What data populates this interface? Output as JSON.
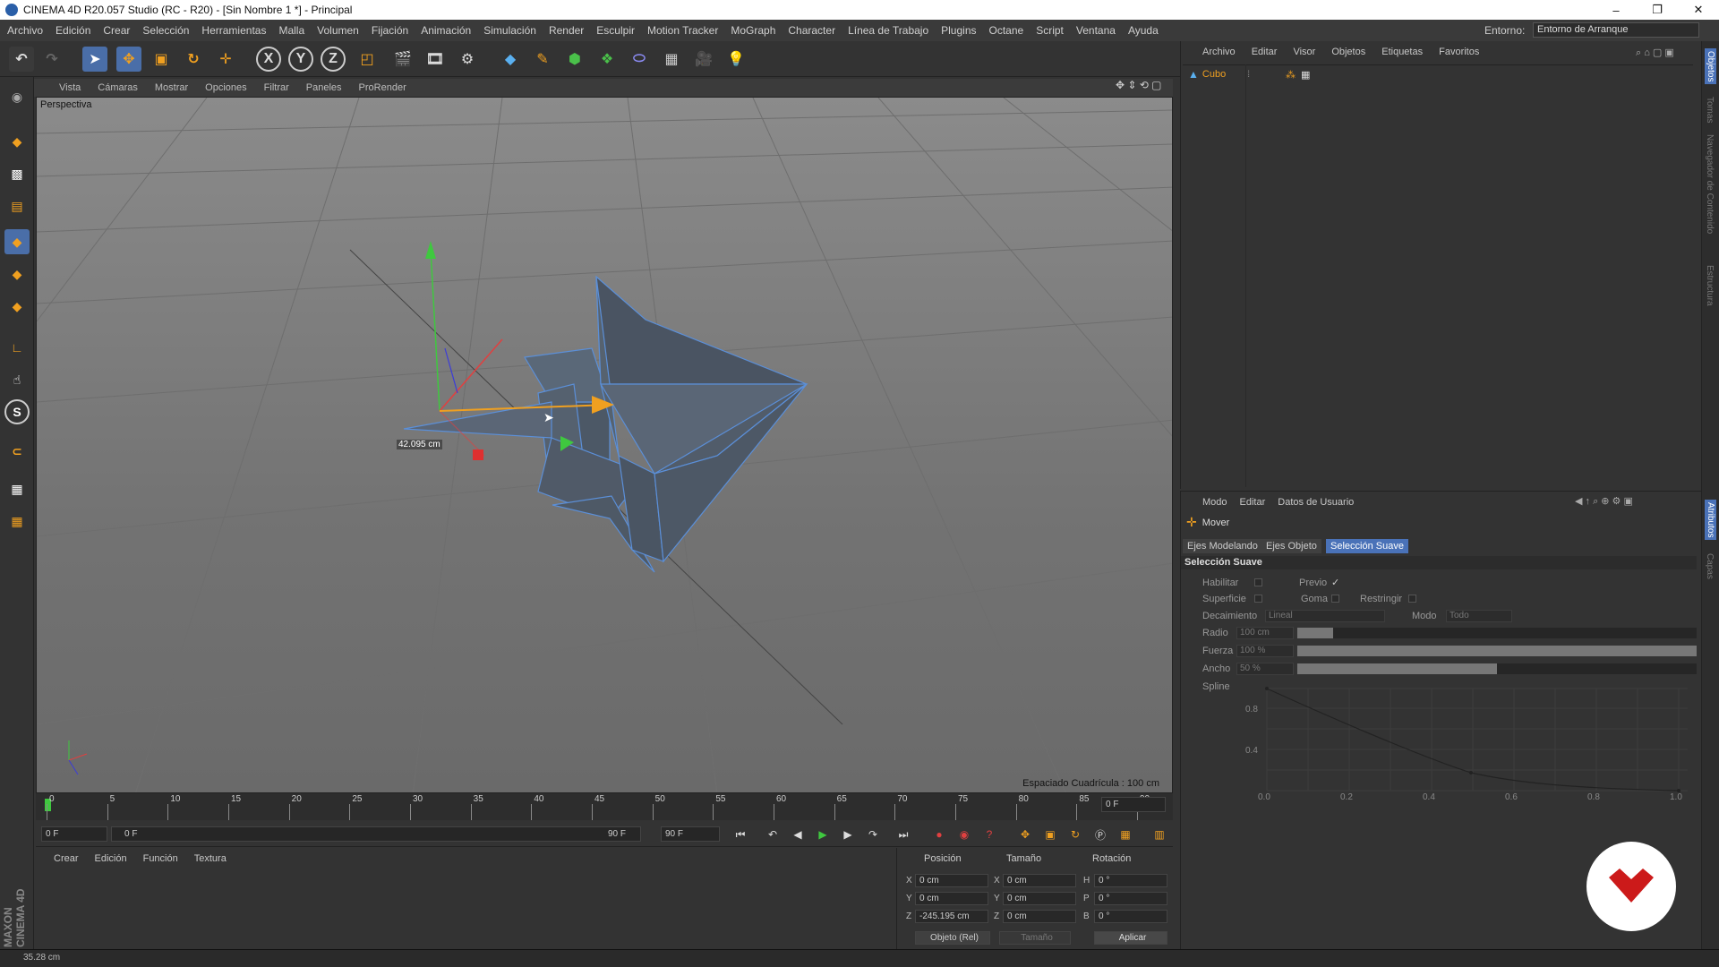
{
  "window": {
    "title": "CINEMA 4D R20.057 Studio (RC - R20) - [Sin Nombre 1 *] - Principal",
    "minimize": "–",
    "maximize": "❐",
    "close": "✕"
  },
  "menubar": {
    "items": [
      "Archivo",
      "Edición",
      "Crear",
      "Selección",
      "Herramientas",
      "Malla",
      "Volumen",
      "Fijación",
      "Animación",
      "Simulación",
      "Render",
      "Esculpir",
      "Motion Tracker",
      "MoGraph",
      "Character",
      "Línea de Trabajo",
      "Plugins",
      "Octane",
      "Script",
      "Ventana",
      "Ayuda"
    ],
    "env_label": "Entorno:",
    "env_value": "Entorno de Arranque"
  },
  "toolbar": {
    "axis_x": "X",
    "axis_y": "Y",
    "axis_z": "Z"
  },
  "lefttools": {
    "s_label": "S"
  },
  "viewport": {
    "menu": [
      "Vista",
      "Cámaras",
      "Mostrar",
      "Opciones",
      "Filtrar",
      "Paneles",
      "ProRender"
    ],
    "label": "Perspectiva",
    "grid_spacing": "Espaciado Cuadrícula : 100 cm",
    "measure": "42.095 cm"
  },
  "timeline": {
    "ticks": [
      "0",
      "5",
      "10",
      "15",
      "20",
      "25",
      "30",
      "35",
      "40",
      "45",
      "50",
      "55",
      "60",
      "65",
      "70",
      "75",
      "80",
      "85",
      "90"
    ],
    "current_frame": "0 F",
    "start_field": "0 F",
    "range_start": "0 F",
    "range_end": "90 F",
    "end_field": "90 F",
    "right_field": "0 F"
  },
  "materials": {
    "menu": [
      "Crear",
      "Edición",
      "Función",
      "Textura"
    ]
  },
  "coords": {
    "pos_hdr": "Posición",
    "size_hdr": "Tamaño",
    "rot_hdr": "Rotación",
    "px": "0 cm",
    "py": "0 cm",
    "pz": "-245.195 cm",
    "sx": "0 cm",
    "sy": "0 cm",
    "sz": "0 cm",
    "rh": "0 °",
    "rp": "0 °",
    "rb": "0 °",
    "lx": "X",
    "ly": "Y",
    "lz": "Z",
    "lh": "H",
    "lp": "P",
    "lb": "B",
    "mode": "Objeto (Rel)",
    "size_mode": "Tamaño",
    "apply": "Aplicar"
  },
  "objects": {
    "menu": [
      "Archivo",
      "Editar",
      "Visor",
      "Objetos",
      "Etiquetas",
      "Favoritos"
    ],
    "items": [
      {
        "name": "Cubo"
      }
    ]
  },
  "attributes": {
    "menu": [
      "Modo",
      "Editar",
      "Datos de Usuario"
    ],
    "tool": "Mover",
    "tabs": [
      "Ejes Modelando",
      "Ejes Objeto",
      "Selección Suave"
    ],
    "active_tab": "Selección Suave",
    "section": "Selección Suave",
    "habilitar": "Habilitar",
    "previo": "Previo",
    "previo_check": "✓",
    "superficie": "Superficie",
    "goma": "Goma",
    "restringir": "Restringir",
    "decaimiento": "Decaimiento",
    "decaimiento_val": "Lineal",
    "modo": "Modo",
    "modo_val": "Todo",
    "radio": "Radio",
    "radio_val": "100 cm",
    "radio_level": 0.09,
    "fuerza": "Fuerza",
    "fuerza_val": "100 %",
    "fuerza_level": 1.0,
    "ancho": "Ancho",
    "ancho_val": "50 %",
    "ancho_level": 0.5,
    "spline": "Spline",
    "graph_y": [
      "0.8",
      "0.4"
    ],
    "graph_x": [
      "0.0",
      "0.2",
      "0.4",
      "0.6",
      "0.8",
      "1.0"
    ]
  },
  "rightstrip": {
    "tabs": [
      "Objetos",
      "Tomas",
      "Navegador de Contenido",
      "Estructura",
      "Atributos",
      "Capas"
    ]
  },
  "branding": {
    "maxon": "MAXON CINEMA 4D"
  },
  "status": {
    "text": "35.28 cm"
  },
  "colors": {
    "accent": "#4a72b8",
    "object_orange": "#f0a020",
    "bg": "#333333"
  }
}
